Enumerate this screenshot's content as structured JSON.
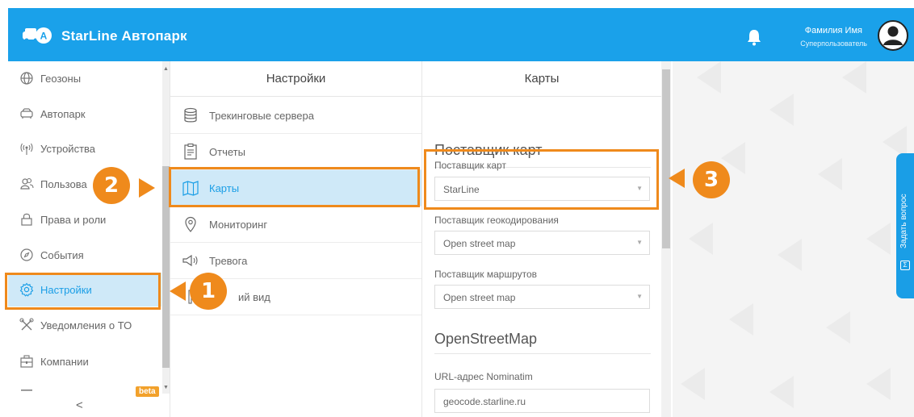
{
  "header": {
    "app_title": "StarLine Автопарк",
    "user_name": "Фамилия Имя",
    "user_role": "Суперпользователь"
  },
  "sidebar": {
    "items": [
      {
        "label": "Геозоны",
        "icon": "globe-icon"
      },
      {
        "label": "Автопарк",
        "icon": "car-icon"
      },
      {
        "label": "Устройства",
        "icon": "signal-icon"
      },
      {
        "label": "Пользова",
        "icon": "users-icon"
      },
      {
        "label": "Права и роли",
        "icon": "lock-icon"
      },
      {
        "label": "События",
        "icon": "compass-icon"
      },
      {
        "label": "Настройки",
        "icon": "gear-icon",
        "active": true
      },
      {
        "label": "Уведомления о ТО",
        "icon": "wrench-icon"
      },
      {
        "label": "Компании",
        "icon": "company-icon"
      }
    ],
    "beta_badge": "beta",
    "collapse_label": "<"
  },
  "settings": {
    "title": "Настройки",
    "items": [
      {
        "label": "Трекинговые сервера",
        "icon": "database-icon"
      },
      {
        "label": "Отчеты",
        "icon": "clipboard-icon"
      },
      {
        "label": "Карты",
        "icon": "map-icon",
        "active": true
      },
      {
        "label": "Мониторинг",
        "icon": "location-pin-icon"
      },
      {
        "label": "Тревога",
        "icon": "megaphone-icon"
      },
      {
        "label": "ий вид",
        "icon": "appearance-icon"
      }
    ]
  },
  "maps": {
    "title": "Карты",
    "provider_section": "Поставщик карт",
    "map_provider_label": "Поставщик карт",
    "map_provider_value": "StarLine",
    "geocoding_label": "Поставщик геокодирования",
    "geocoding_value": "Open street map",
    "routes_label": "Поставщик маршрутов",
    "routes_value": "Open street map",
    "osm_section": "OpenStreetMap",
    "nominatim_label": "URL-адрес Nominatim",
    "nominatim_value": "geocode.starline.ru"
  },
  "ask_question": "Задать вопрос",
  "callouts": {
    "one": "1",
    "two": "2",
    "three": "3"
  },
  "colors": {
    "header_blue": "#1aa1ea",
    "accent_orange": "#ef8a1c",
    "active_bg": "#cfe9f8",
    "active_text": "#1a9ee6",
    "beta_orange": "#f2a12b"
  }
}
